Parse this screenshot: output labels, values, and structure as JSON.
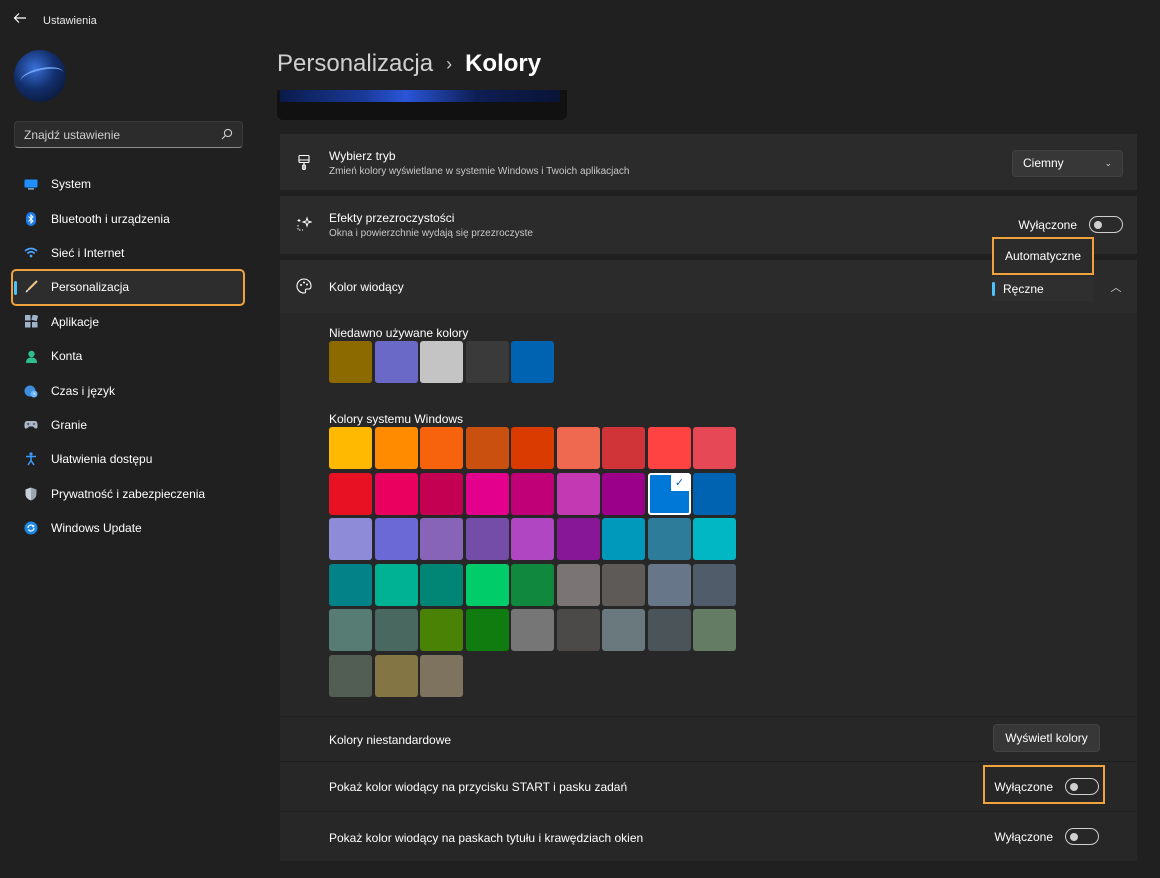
{
  "window": {
    "title": "Ustawienia"
  },
  "search": {
    "placeholder": "Znajdź ustawienie"
  },
  "sidebar": {
    "items": [
      {
        "label": "System",
        "icon": "monitor-icon"
      },
      {
        "label": "Bluetooth i urządzenia",
        "icon": "bluetooth-icon"
      },
      {
        "label": "Sieć i Internet",
        "icon": "wifi-icon"
      },
      {
        "label": "Personalizacja",
        "icon": "brush-icon",
        "selected": true
      },
      {
        "label": "Aplikacje",
        "icon": "apps-icon"
      },
      {
        "label": "Konta",
        "icon": "person-icon"
      },
      {
        "label": "Czas i język",
        "icon": "globe-clock-icon"
      },
      {
        "label": "Granie",
        "icon": "gamepad-icon"
      },
      {
        "label": "Ułatwienia dostępu",
        "icon": "accessibility-icon"
      },
      {
        "label": "Prywatność i zabezpieczenia",
        "icon": "shield-icon"
      },
      {
        "label": "Windows Update",
        "icon": "update-icon"
      }
    ]
  },
  "breadcrumb": {
    "parent": "Personalizacja",
    "current": "Kolory"
  },
  "mode": {
    "title": "Wybierz tryb",
    "description": "Zmień kolory wyświetlane w systemie Windows i Twoich aplikacjach",
    "value": "Ciemny"
  },
  "transparency": {
    "title": "Efekty przezroczystości",
    "description": "Okna i powierzchnie wydają się przezroczyste",
    "state": "Wyłączone"
  },
  "accent": {
    "title": "Kolor wiodący",
    "options": [
      "Automatyczne",
      "Ręczne"
    ],
    "selected": "Ręczne",
    "recent_label": "Niedawno używane kolory",
    "recent_colors": [
      "#8c6a00",
      "#6b69c7",
      "#c4c4c4",
      "#3a3a3a",
      "#0063b1"
    ],
    "windows_label": "Kolory systemu Windows",
    "windows_colors": [
      [
        "#ffb900",
        "#ff8c00",
        "#f7630c",
        "#ca5010",
        "#da3b01",
        "#ef6950",
        "#d13438",
        "#ff4343",
        "#e74856"
      ],
      [
        "#e81123",
        "#ea005e",
        "#c30052",
        "#e3008c",
        "#bf0077",
        "#c239b3",
        "#9a0089",
        "#0078d7",
        "#0063b1"
      ],
      [
        "#8e8cd8",
        "#6b69d6",
        "#8764b8",
        "#744da9",
        "#b146c2",
        "#881798",
        "#0099bc",
        "#2d7d9a",
        "#00b7c3"
      ],
      [
        "#038387",
        "#00b294",
        "#018574",
        "#00cc6a",
        "#10893e",
        "#7a7574",
        "#5d5a58",
        "#68768a",
        "#515c6b"
      ],
      [
        "#567c73",
        "#486860",
        "#498205",
        "#107c10",
        "#767676",
        "#4c4a48",
        "#69797e",
        "#4a5459",
        "#647c64"
      ],
      [
        "#525e54",
        "#847545",
        "#7e735f"
      ]
    ],
    "selected_color": "#0078d7"
  },
  "custom_colors": {
    "label": "Kolory niestandardowe",
    "button": "Wyświetl kolory"
  },
  "show_on_start": {
    "label": "Pokaż kolor wiodący na przycisku START i pasku zadań",
    "state": "Wyłączone"
  },
  "show_on_titlebars": {
    "label": "Pokaż kolor wiodący na paskach tytułu i krawędziach okien",
    "state": "Wyłączone"
  },
  "colors": {
    "highlight": "#f0a33c",
    "accent_blue": "#4cc2ff",
    "background": "#202020",
    "card": "#2b2b2b"
  }
}
